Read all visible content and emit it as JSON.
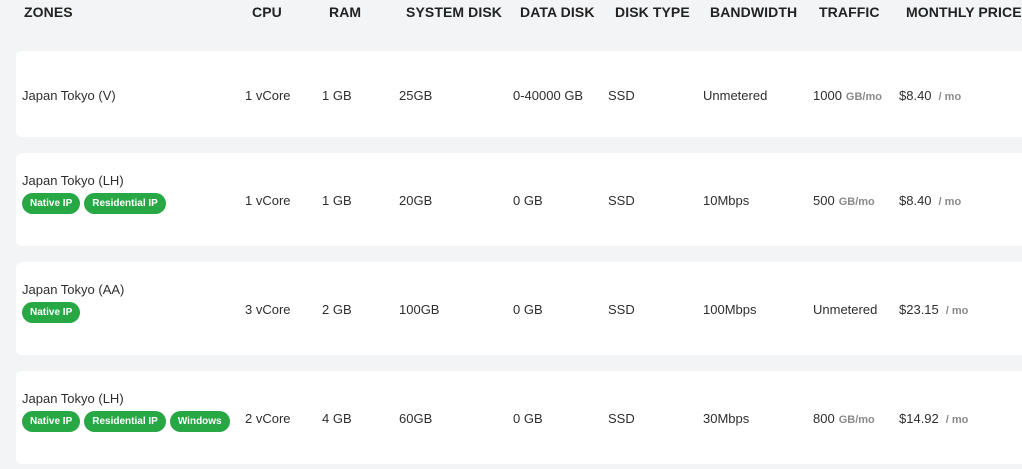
{
  "header": {
    "zones": "ZONES",
    "cpu": "CPU",
    "ram": "RAM",
    "system_disk": "SYSTEM DISK",
    "data_disk": "DATA DISK",
    "disk_type": "DISK TYPE",
    "bandwidth": "BANDWIDTH",
    "traffic": "TRAFFIC",
    "monthly_price": "MONTHLY PRICE"
  },
  "rows": [
    {
      "zone": "Japan Tokyo (V)",
      "badges": [],
      "cpu": "1 vCore",
      "ram": "1 GB",
      "system_disk": "25GB",
      "data_disk": "0-40000 GB",
      "disk_type": "SSD",
      "bandwidth": "Unmetered",
      "traffic_value": "1000",
      "traffic_unit": "GB/mo",
      "price": "$8.40",
      "price_period": "/ mo"
    },
    {
      "zone": "Japan Tokyo (LH)",
      "badges": [
        "Native IP",
        "Residential IP"
      ],
      "cpu": "1 vCore",
      "ram": "1 GB",
      "system_disk": "20GB",
      "data_disk": "0 GB",
      "disk_type": "SSD",
      "bandwidth": "10Mbps",
      "traffic_value": "500",
      "traffic_unit": "GB/mo",
      "price": "$8.40",
      "price_period": "/ mo"
    },
    {
      "zone": "Japan Tokyo (AA)",
      "badges": [
        "Native IP"
      ],
      "cpu": "3 vCore",
      "ram": "2 GB",
      "system_disk": "100GB",
      "data_disk": "0 GB",
      "disk_type": "SSD",
      "bandwidth": "100Mbps",
      "traffic_value": "Unmetered",
      "traffic_unit": "",
      "price": "$23.15",
      "price_period": "/ mo"
    },
    {
      "zone": "Japan Tokyo (LH)",
      "badges": [
        "Native IP",
        "Residential IP",
        "Windows"
      ],
      "cpu": "2 vCore",
      "ram": "4 GB",
      "system_disk": "60GB",
      "data_disk": "0 GB",
      "disk_type": "SSD",
      "bandwidth": "30Mbps",
      "traffic_value": "800",
      "traffic_unit": "GB/mo",
      "price": "$14.92",
      "price_period": "/ mo"
    }
  ],
  "colors": {
    "badge": "#28a745",
    "card": "#ffffff",
    "background": "#f3f4f6"
  }
}
